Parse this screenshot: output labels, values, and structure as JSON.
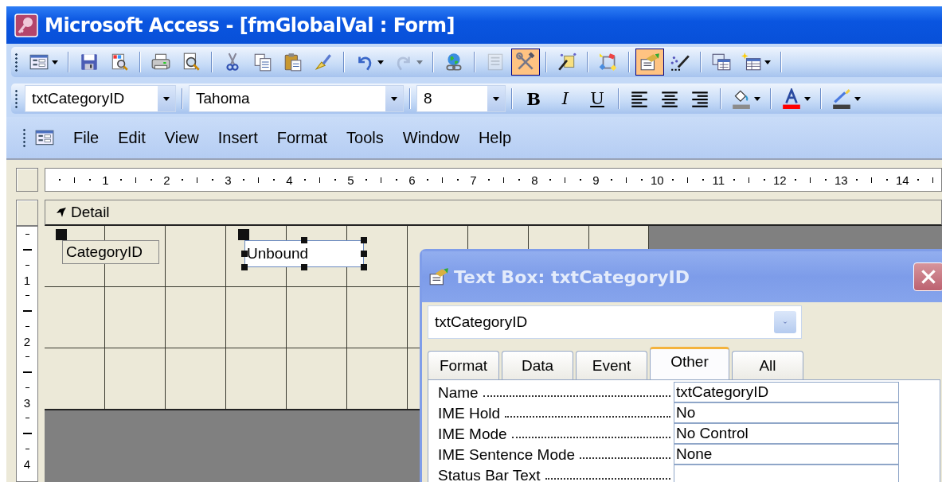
{
  "window": {
    "title": "Microsoft Access - [fmGlobalVal : Form]"
  },
  "design_toolbar": {
    "items": [
      {
        "kind": "button",
        "pressed": false,
        "dropdown": true,
        "disabled": false
      },
      {
        "kind": "separator"
      },
      {
        "kind": "button",
        "pressed": false,
        "dropdown": false,
        "disabled": false
      },
      {
        "kind": "button",
        "pressed": false,
        "dropdown": false,
        "disabled": false
      },
      {
        "kind": "separator"
      },
      {
        "kind": "button",
        "pressed": false,
        "dropdown": false,
        "disabled": false
      },
      {
        "kind": "button",
        "pressed": false,
        "dropdown": false,
        "disabled": false
      },
      {
        "kind": "separator"
      },
      {
        "kind": "button",
        "pressed": false,
        "dropdown": false,
        "disabled": false
      },
      {
        "kind": "button",
        "pressed": false,
        "dropdown": false,
        "disabled": false
      },
      {
        "kind": "button",
        "pressed": false,
        "dropdown": false,
        "disabled": false
      },
      {
        "kind": "button",
        "pressed": false,
        "dropdown": false,
        "disabled": false
      },
      {
        "kind": "separator"
      },
      {
        "kind": "button",
        "pressed": false,
        "dropdown": true,
        "disabled": false
      },
      {
        "kind": "button",
        "pressed": false,
        "dropdown": true,
        "disabled": true
      },
      {
        "kind": "separator"
      },
      {
        "kind": "button",
        "pressed": false,
        "dropdown": false,
        "disabled": false
      },
      {
        "kind": "separator"
      },
      {
        "kind": "button",
        "pressed": false,
        "dropdown": false,
        "disabled": true
      },
      {
        "kind": "button",
        "pressed": true,
        "dropdown": false,
        "disabled": false
      },
      {
        "kind": "separator"
      },
      {
        "kind": "button",
        "pressed": false,
        "dropdown": false,
        "disabled": false
      },
      {
        "kind": "separator"
      },
      {
        "kind": "button",
        "pressed": false,
        "dropdown": false,
        "disabled": false
      },
      {
        "kind": "separator"
      },
      {
        "kind": "button",
        "pressed": true,
        "dropdown": false,
        "disabled": false
      },
      {
        "kind": "button",
        "pressed": false,
        "dropdown": false,
        "disabled": false
      },
      {
        "kind": "separator"
      },
      {
        "kind": "button",
        "pressed": false,
        "dropdown": false,
        "disabled": false
      },
      {
        "kind": "button",
        "pressed": false,
        "dropdown": true,
        "disabled": false
      },
      {
        "kind": "separator"
      }
    ]
  },
  "format_toolbar": {
    "object_box": {
      "value": "txtCategoryID"
    },
    "font_box": {
      "value": "Tahoma"
    },
    "size_box": {
      "value": "8"
    },
    "style_buttons": [
      {
        "label": "B",
        "pressed": false
      },
      {
        "label": "I",
        "pressed": false
      },
      {
        "label": "U",
        "pressed": false
      }
    ],
    "align_buttons": [
      {
        "pressed": false
      },
      {
        "pressed": false
      },
      {
        "pressed": false
      }
    ],
    "color_buttons": [
      {
        "color": "#8c8c8c"
      },
      {
        "color": "#ff0000"
      },
      {
        "color": "#404040"
      }
    ]
  },
  "menu_bar": {
    "items": [
      "File",
      "Edit",
      "View",
      "Insert",
      "Format",
      "Tools",
      "Window",
      "Help"
    ]
  },
  "horizontal_ruler": {
    "labels": [
      "1",
      "2",
      "3",
      "4",
      "5",
      "6",
      "7",
      "8",
      "9",
      "10",
      "11",
      "12",
      "13",
      "14"
    ]
  },
  "vertical_ruler": {
    "labels": [
      "1",
      "2",
      "3",
      "4"
    ]
  },
  "form_section": {
    "label": "Detail"
  },
  "controls": [
    {
      "kind": "label",
      "text": "CategoryID",
      "sizing_handles": false
    },
    {
      "kind": "textbox",
      "text": "Unbound",
      "sizing_handles": true
    }
  ],
  "property_sheet": {
    "title": "Text Box: txtCategoryID",
    "object_box": {
      "value": "txtCategoryID"
    },
    "tabs": [
      {
        "label": "Format",
        "selected": false
      },
      {
        "label": "Data",
        "selected": false
      },
      {
        "label": "Event",
        "selected": false
      },
      {
        "label": "Other",
        "selected": true
      },
      {
        "label": "All",
        "selected": false
      }
    ],
    "properties": [
      {
        "name": "Name",
        "value": "txtCategoryID"
      },
      {
        "name": "IME Hold",
        "value": "No"
      },
      {
        "name": "IME Mode",
        "value": "No Control"
      },
      {
        "name": "IME Sentence Mode",
        "value": "None"
      },
      {
        "name": "Status Bar Text"
      }
    ]
  }
}
